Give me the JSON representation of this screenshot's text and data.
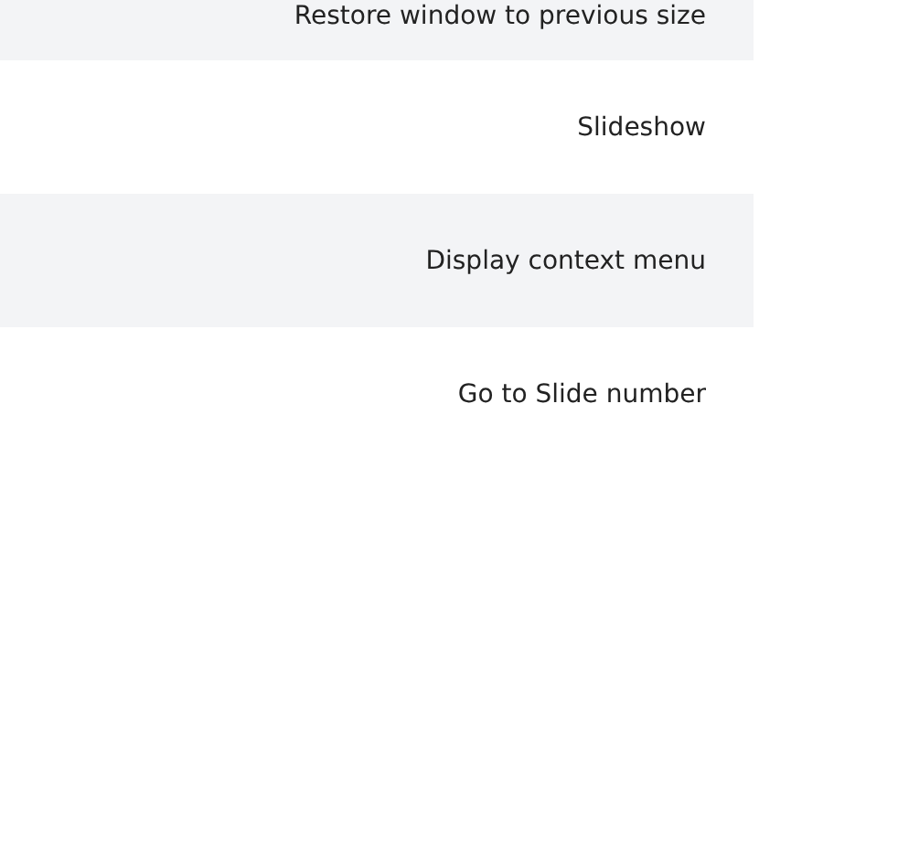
{
  "rows": [
    {
      "label": "Restore window to previous size",
      "shaded": true
    },
    {
      "label": "Slideshow",
      "shaded": false
    },
    {
      "label": "Display context menu",
      "shaded": true
    },
    {
      "label": "Go to Slide number",
      "shaded": false
    }
  ]
}
